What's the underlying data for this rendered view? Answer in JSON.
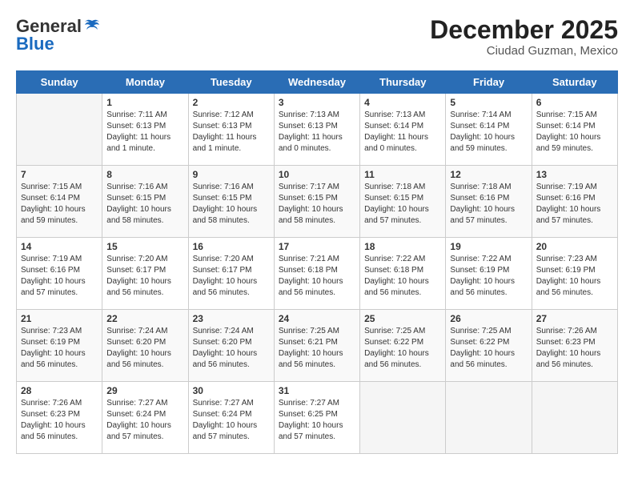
{
  "header": {
    "logo_general": "General",
    "logo_blue": "Blue",
    "month": "December 2025",
    "location": "Ciudad Guzman, Mexico"
  },
  "days_of_week": [
    "Sunday",
    "Monday",
    "Tuesday",
    "Wednesday",
    "Thursday",
    "Friday",
    "Saturday"
  ],
  "weeks": [
    [
      {
        "day": "",
        "sunrise": "",
        "sunset": "",
        "daylight": ""
      },
      {
        "day": "1",
        "sunrise": "Sunrise: 7:11 AM",
        "sunset": "Sunset: 6:13 PM",
        "daylight": "Daylight: 11 hours and 1 minute."
      },
      {
        "day": "2",
        "sunrise": "Sunrise: 7:12 AM",
        "sunset": "Sunset: 6:13 PM",
        "daylight": "Daylight: 11 hours and 1 minute."
      },
      {
        "day": "3",
        "sunrise": "Sunrise: 7:13 AM",
        "sunset": "Sunset: 6:13 PM",
        "daylight": "Daylight: 11 hours and 0 minutes."
      },
      {
        "day": "4",
        "sunrise": "Sunrise: 7:13 AM",
        "sunset": "Sunset: 6:14 PM",
        "daylight": "Daylight: 11 hours and 0 minutes."
      },
      {
        "day": "5",
        "sunrise": "Sunrise: 7:14 AM",
        "sunset": "Sunset: 6:14 PM",
        "daylight": "Daylight: 10 hours and 59 minutes."
      },
      {
        "day": "6",
        "sunrise": "Sunrise: 7:15 AM",
        "sunset": "Sunset: 6:14 PM",
        "daylight": "Daylight: 10 hours and 59 minutes."
      }
    ],
    [
      {
        "day": "7",
        "sunrise": "Sunrise: 7:15 AM",
        "sunset": "Sunset: 6:14 PM",
        "daylight": "Daylight: 10 hours and 59 minutes."
      },
      {
        "day": "8",
        "sunrise": "Sunrise: 7:16 AM",
        "sunset": "Sunset: 6:15 PM",
        "daylight": "Daylight: 10 hours and 58 minutes."
      },
      {
        "day": "9",
        "sunrise": "Sunrise: 7:16 AM",
        "sunset": "Sunset: 6:15 PM",
        "daylight": "Daylight: 10 hours and 58 minutes."
      },
      {
        "day": "10",
        "sunrise": "Sunrise: 7:17 AM",
        "sunset": "Sunset: 6:15 PM",
        "daylight": "Daylight: 10 hours and 58 minutes."
      },
      {
        "day": "11",
        "sunrise": "Sunrise: 7:18 AM",
        "sunset": "Sunset: 6:15 PM",
        "daylight": "Daylight: 10 hours and 57 minutes."
      },
      {
        "day": "12",
        "sunrise": "Sunrise: 7:18 AM",
        "sunset": "Sunset: 6:16 PM",
        "daylight": "Daylight: 10 hours and 57 minutes."
      },
      {
        "day": "13",
        "sunrise": "Sunrise: 7:19 AM",
        "sunset": "Sunset: 6:16 PM",
        "daylight": "Daylight: 10 hours and 57 minutes."
      }
    ],
    [
      {
        "day": "14",
        "sunrise": "Sunrise: 7:19 AM",
        "sunset": "Sunset: 6:16 PM",
        "daylight": "Daylight: 10 hours and 57 minutes."
      },
      {
        "day": "15",
        "sunrise": "Sunrise: 7:20 AM",
        "sunset": "Sunset: 6:17 PM",
        "daylight": "Daylight: 10 hours and 56 minutes."
      },
      {
        "day": "16",
        "sunrise": "Sunrise: 7:20 AM",
        "sunset": "Sunset: 6:17 PM",
        "daylight": "Daylight: 10 hours and 56 minutes."
      },
      {
        "day": "17",
        "sunrise": "Sunrise: 7:21 AM",
        "sunset": "Sunset: 6:18 PM",
        "daylight": "Daylight: 10 hours and 56 minutes."
      },
      {
        "day": "18",
        "sunrise": "Sunrise: 7:22 AM",
        "sunset": "Sunset: 6:18 PM",
        "daylight": "Daylight: 10 hours and 56 minutes."
      },
      {
        "day": "19",
        "sunrise": "Sunrise: 7:22 AM",
        "sunset": "Sunset: 6:19 PM",
        "daylight": "Daylight: 10 hours and 56 minutes."
      },
      {
        "day": "20",
        "sunrise": "Sunrise: 7:23 AM",
        "sunset": "Sunset: 6:19 PM",
        "daylight": "Daylight: 10 hours and 56 minutes."
      }
    ],
    [
      {
        "day": "21",
        "sunrise": "Sunrise: 7:23 AM",
        "sunset": "Sunset: 6:19 PM",
        "daylight": "Daylight: 10 hours and 56 minutes."
      },
      {
        "day": "22",
        "sunrise": "Sunrise: 7:24 AM",
        "sunset": "Sunset: 6:20 PM",
        "daylight": "Daylight: 10 hours and 56 minutes."
      },
      {
        "day": "23",
        "sunrise": "Sunrise: 7:24 AM",
        "sunset": "Sunset: 6:20 PM",
        "daylight": "Daylight: 10 hours and 56 minutes."
      },
      {
        "day": "24",
        "sunrise": "Sunrise: 7:25 AM",
        "sunset": "Sunset: 6:21 PM",
        "daylight": "Daylight: 10 hours and 56 minutes."
      },
      {
        "day": "25",
        "sunrise": "Sunrise: 7:25 AM",
        "sunset": "Sunset: 6:22 PM",
        "daylight": "Daylight: 10 hours and 56 minutes."
      },
      {
        "day": "26",
        "sunrise": "Sunrise: 7:25 AM",
        "sunset": "Sunset: 6:22 PM",
        "daylight": "Daylight: 10 hours and 56 minutes."
      },
      {
        "day": "27",
        "sunrise": "Sunrise: 7:26 AM",
        "sunset": "Sunset: 6:23 PM",
        "daylight": "Daylight: 10 hours and 56 minutes."
      }
    ],
    [
      {
        "day": "28",
        "sunrise": "Sunrise: 7:26 AM",
        "sunset": "Sunset: 6:23 PM",
        "daylight": "Daylight: 10 hours and 56 minutes."
      },
      {
        "day": "29",
        "sunrise": "Sunrise: 7:27 AM",
        "sunset": "Sunset: 6:24 PM",
        "daylight": "Daylight: 10 hours and 57 minutes."
      },
      {
        "day": "30",
        "sunrise": "Sunrise: 7:27 AM",
        "sunset": "Sunset: 6:24 PM",
        "daylight": "Daylight: 10 hours and 57 minutes."
      },
      {
        "day": "31",
        "sunrise": "Sunrise: 7:27 AM",
        "sunset": "Sunset: 6:25 PM",
        "daylight": "Daylight: 10 hours and 57 minutes."
      },
      {
        "day": "",
        "sunrise": "",
        "sunset": "",
        "daylight": ""
      },
      {
        "day": "",
        "sunrise": "",
        "sunset": "",
        "daylight": ""
      },
      {
        "day": "",
        "sunrise": "",
        "sunset": "",
        "daylight": ""
      }
    ]
  ]
}
